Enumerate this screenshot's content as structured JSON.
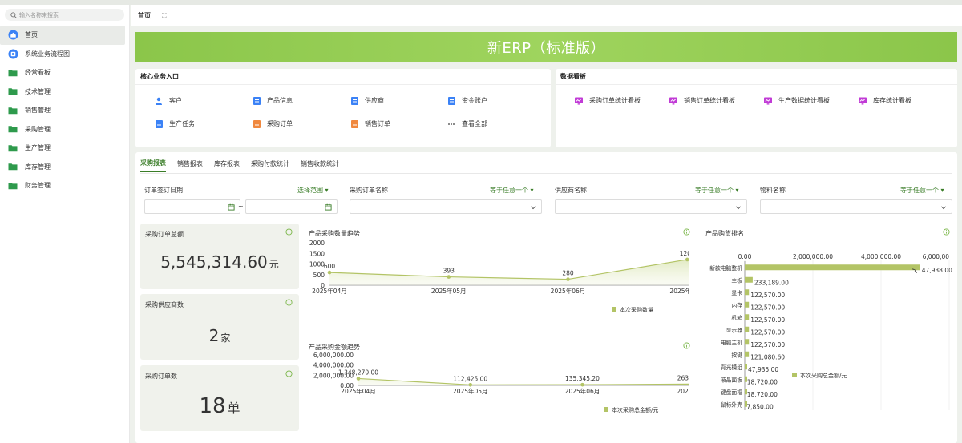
{
  "colors": {
    "accent": "#3a7d28",
    "bar": "#b3c466",
    "banner": "#8bc64a",
    "kpi_bg": "#f0f2ec"
  },
  "sidebar": {
    "search_placeholder": "输入名称来搜索",
    "items": [
      {
        "label": "首页",
        "icon": "home-icon"
      },
      {
        "label": "系统业务流程图",
        "icon": "workflow-icon"
      },
      {
        "label": "经营看板",
        "icon": "folder-icon"
      },
      {
        "label": "技术管理",
        "icon": "folder-icon"
      },
      {
        "label": "销售管理",
        "icon": "folder-icon"
      },
      {
        "label": "采购管理",
        "icon": "folder-icon"
      },
      {
        "label": "生产管理",
        "icon": "folder-icon"
      },
      {
        "label": "库存管理",
        "icon": "folder-icon"
      },
      {
        "label": "财务管理",
        "icon": "folder-icon"
      }
    ]
  },
  "header": {
    "tab": "首页",
    "fullscreen_icon": "⛶"
  },
  "banner": {
    "title": "新ERP（标准版）"
  },
  "core": {
    "title": "核心业务入口",
    "entries": [
      {
        "label": "客户",
        "icon": "user-icon",
        "color": "#3b82f6"
      },
      {
        "label": "产品信息",
        "icon": "doc-icon",
        "color": "#3b82f6"
      },
      {
        "label": "供应商",
        "icon": "doc-icon",
        "color": "#3b82f6"
      },
      {
        "label": "资金账户",
        "icon": "doc-icon",
        "color": "#3b82f6"
      },
      {
        "label": "生产任务",
        "icon": "doc-icon",
        "color": "#3b82f6"
      },
      {
        "label": "采购订单",
        "icon": "doc-icon",
        "color": "#f0883e"
      },
      {
        "label": "销售订单",
        "icon": "doc-icon",
        "color": "#f0883e"
      },
      {
        "label": "查看全部",
        "icon": "more-icon",
        "color": "#888888"
      }
    ]
  },
  "dashboards": {
    "title": "数据看板",
    "entries": [
      {
        "label": "采购订单统计看板",
        "icon": "board-icon"
      },
      {
        "label": "销售订单统计看板",
        "icon": "board-icon"
      },
      {
        "label": "生产数据统计看板",
        "icon": "board-icon"
      },
      {
        "label": "库存统计看板",
        "icon": "board-icon"
      }
    ]
  },
  "reports": {
    "tabs": [
      "采购报表",
      "销售报表",
      "库存报表",
      "采购付款统计",
      "销售收款统计"
    ],
    "filters": [
      {
        "label": "订单签订日期",
        "op": "选择范围 ▾",
        "sep": "~"
      },
      {
        "label": "采购订单名称",
        "op": "等于任意一个 ▾"
      },
      {
        "label": "供应商名称",
        "op": "等于任意一个 ▾"
      },
      {
        "label": "物料名称",
        "op": "等于任意一个 ▾"
      }
    ]
  },
  "kpis": [
    {
      "title": "采购订单总额",
      "value": "5,545,314.60",
      "unit": "元"
    },
    {
      "title": "采购供应商数",
      "value": "2",
      "unit": "家"
    },
    {
      "title": "采购订单数",
      "value": "18",
      "unit": "单"
    }
  ],
  "chart_data": [
    {
      "type": "area",
      "title": "产品采购数量趋势",
      "categories": [
        "2025年04月",
        "2025年05月",
        "2025年06月",
        "2025年07月",
        "2025年09月"
      ],
      "series": [
        {
          "name": "本次采购数量",
          "values": [
            600,
            393,
            280,
            1209,
            1951
          ]
        }
      ],
      "value_labels": [
        "600",
        "393",
        "280",
        "1209",
        "1951"
      ],
      "yticks": [
        "2000",
        "1500",
        "1000",
        "500",
        "0"
      ],
      "ylim": [
        0,
        2000
      ],
      "legend": "bottom"
    },
    {
      "type": "area",
      "title": "产品采购金额趋势",
      "categories": [
        "2025年04月",
        "2025年05月",
        "2025年06月",
        "2025年07月",
        "2025年09月"
      ],
      "series": [
        {
          "name": "本次采购总金额/元",
          "values": [
            1348270.0,
            112425.0,
            135345.2,
            263357.0,
            5231901.0
          ]
        }
      ],
      "value_labels": [
        "1,348,270.00",
        "112,425.00",
        "135,345.20",
        "263,357.00",
        "5,231,901.00"
      ],
      "yticks": [
        "6,000,000.00",
        "4,000,000.00",
        "2,000,000.00",
        "0.00"
      ],
      "ylim": [
        0,
        6000000
      ],
      "legend": "bottom"
    },
    {
      "type": "bar",
      "orientation": "horizontal",
      "title": "产品购货排名",
      "categories": [
        "新款电脑整机",
        "主板",
        "显卡",
        "内存",
        "机箱",
        "显示器",
        "电脑主机",
        "按键",
        "背光模组",
        "液晶面板",
        "键盘面框",
        "鼠标外壳"
      ],
      "series": [
        {
          "name": "本次采购总金额/元",
          "values": [
            5147938.0,
            233189.0,
            122570.0,
            122570.0,
            122570.0,
            122570.0,
            122570.0,
            121080.6,
            47935.0,
            18720.0,
            18720.0,
            7850.0
          ]
        }
      ],
      "value_labels": [
        "5,147,938.00",
        "233,189.00",
        "122,570.00",
        "122,570.00",
        "122,570.00",
        "122,570.00",
        "122,570.00",
        "121,080.60",
        "47,935.00",
        "18,720.00",
        "18,720.00",
        "7,850.00"
      ],
      "xticks": [
        "0.00",
        "2,000,000.00",
        "4,000,000.00",
        "6,000,00"
      ],
      "xlim": [
        0,
        6000000
      ],
      "legend": "bottom"
    }
  ]
}
